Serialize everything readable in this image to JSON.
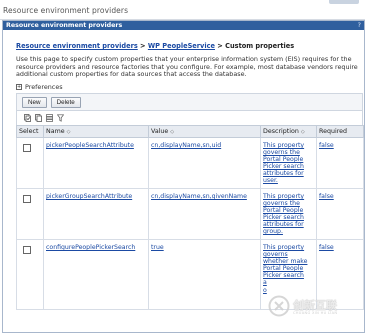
{
  "window": {
    "title": "Resource environment providers"
  },
  "panel": {
    "header": "Resource environment providers",
    "help": "?"
  },
  "breadcrumb": {
    "link1": "Resource environment providers",
    "sep1": " > ",
    "link2": "WP PeopleService",
    "sep2": " > ",
    "current": "Custom properties"
  },
  "description": "Use this page to specify custom properties that your enterprise information system (EIS) requires for the resource providers and resource factories that you configure. For example, most database vendors require additional custom properties for data sources that access the database.",
  "preferences": {
    "label": "Preferences",
    "toggle": "+"
  },
  "toolbar": {
    "new_label": "New",
    "delete_label": "Delete"
  },
  "icons": [
    "select-all-icon",
    "deselect-all-icon",
    "show-filter-icon",
    "clear-filter-icon"
  ],
  "table": {
    "headers": {
      "select": "Select",
      "name": "Name",
      "value": "Value",
      "description": "Description",
      "required": "Required"
    },
    "sort_glyph": "◇",
    "rows": [
      {
        "name": "pickerPeopleSearchAttribute",
        "value": "cn,displayName,sn,uid",
        "description": [
          "This property",
          "governs the",
          "Portal People",
          "Picker search",
          "attributes for",
          "user."
        ],
        "required": "false"
      },
      {
        "name": "pickerGroupSearchAttribute",
        "value": "cn,displayName,sn,givenName",
        "description": [
          "This property",
          "governs the",
          "Portal People",
          "Picker search",
          "attributes for",
          "group."
        ],
        "required": "false"
      },
      {
        "name": "configurePeoplePickerSearch",
        "value": "true",
        "description": [
          "This property",
          "governs",
          "whether make",
          "Portal People",
          "Picker search",
          "a",
          "o"
        ],
        "required": "false"
      }
    ]
  },
  "watermark": {
    "text": "创新互联",
    "sub": "CHUANG XIN HU LIAN"
  },
  "colors": {
    "header_bg": "#2f5f9e",
    "link": "#1b4aa3",
    "grid_header": "#e7ebf1"
  }
}
